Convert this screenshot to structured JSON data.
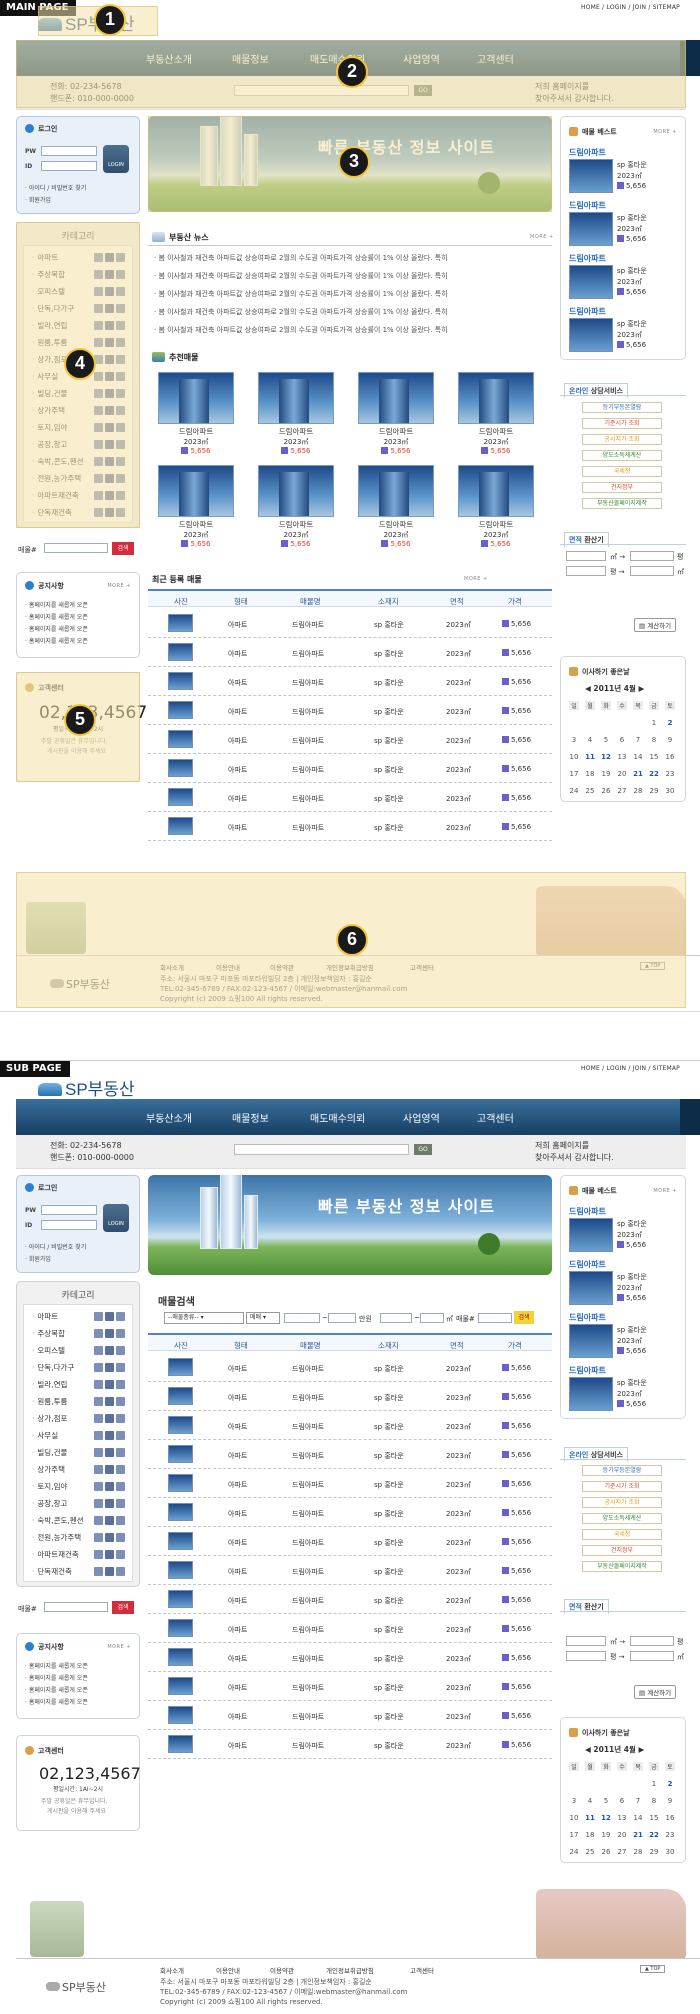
{
  "labels": {
    "main": "MAIN PAGE",
    "sub": "SUB PAGE"
  },
  "util": "HOME / LOGIN / JOIN / SITEMAP",
  "logo": "SP부동산",
  "nav": [
    "부동산소개",
    "매물정보",
    "매도매수의뢰",
    "사업영역",
    "고객센터"
  ],
  "info": {
    "phone": "전화: 02-234-5678",
    "mobile": "핸드폰: 010-000-0000",
    "go": "GO",
    "thanks1": "저희 홈페이지를",
    "thanks2": "찾아주셔서 감사합니다."
  },
  "login": {
    "title": "로그인",
    "pw": "PW",
    "id": "ID",
    "button": "LOGIN",
    "find": "· 아이디 / 비밀번호 찾기",
    "join": "· 회원가입"
  },
  "category": {
    "title": "카테고리",
    "items": [
      "아파트",
      "주상복합",
      "오피스텔",
      "단독,다가구",
      "빌라,연립",
      "원룸,투룸",
      "상가,점포",
      "사무실",
      "빌딩,건물",
      "상가주택",
      "토지,임야",
      "공장,창고",
      "숙박,콘도,펜션",
      "전원,농가주택",
      "아파트재건축",
      "단독재건축"
    ]
  },
  "product_search": {
    "label": "매물#",
    "button": "검색"
  },
  "notice": {
    "title": "공지사항",
    "more": "MORE +",
    "items": [
      "홈페이지를 새롭게 오픈",
      "홈페이지를 새롭게 오픈",
      "홈페이지를 새롭게 오픈",
      "홈페이지를 새롭게 오픈"
    ]
  },
  "cs": {
    "title": "고객센터",
    "phone": "02,123,4567",
    "hours": "평일시간: 1AI~2시",
    "note1": "주말 공휴일은 휴무입니다.",
    "note2": "게시판을 이용해 주세요"
  },
  "banner": {
    "title": "빠른 부동산 정보 사이트"
  },
  "news": {
    "title": "부동산 뉴스",
    "more": "MORE +",
    "items": [
      "봄 이사철과 재건축 아파트값 상승여파로 2월의 수도권 아파트가격 상승률이 1% 이상 올랐다. 특히",
      "봄 이사철과 재건축 아파트값 상승여파로 2월의 수도권 아파트가격 상승률이 1% 이상 올랐다. 특히",
      "봄 이사철과 재건축 아파트값 상승여파로 2월의 수도권 아파트가격 상승률이 1% 이상 올랐다. 특히",
      "봄 이사철과 재건축 아파트값 상승여파로 2월의 수도권 아파트가격 상승률이 1% 이상 올랐다. 특히",
      "봄 이사철과 재건축 아파트값 상승여파로 2월의 수도권 아파트가격 상승률이 1% 이상 올랐다. 특히"
    ]
  },
  "recommend": {
    "title": "추천매물",
    "name": "드림아파트",
    "area": "2023㎡",
    "price": "5,656"
  },
  "recent": {
    "title": "최근 등록 매물",
    "more": "MORE +"
  },
  "table": {
    "headers": [
      "사진",
      "형태",
      "매물명",
      "소재지",
      "면적",
      "가격"
    ],
    "type": "아파트",
    "name": "드림아파트",
    "loc": "sp 홍타운",
    "area": "2023㎡",
    "price": "5,656"
  },
  "best": {
    "title": "매물 베스트",
    "more": "MORE +",
    "name": "드림아파트",
    "loc": "sp 홍타운",
    "area": "2023㎡",
    "price": "5,656"
  },
  "online": {
    "title_a": "온라인",
    "title_b": "상담서비스",
    "items": [
      "등기부등본열람",
      "기준시가 조회",
      "공시지가 조회",
      "양도소득세계산",
      "국세청",
      "건지정부",
      "부동산몰페이지제작"
    ]
  },
  "area_calc": {
    "title_a": "면적",
    "title_b": "환산기",
    "unit1": "㎡ →",
    "unit2": "평 →",
    "out1": "평",
    "out2": "㎡",
    "button": "계산하기"
  },
  "calendar": {
    "title": "이사하기 좋은날",
    "month": "◀ 2011년 4월 ▶",
    "days": [
      "일",
      "월",
      "화",
      "수",
      "목",
      "금",
      "토"
    ],
    "weeks": [
      [
        "",
        "",
        "",
        "",
        "",
        "1",
        "2"
      ],
      [
        "3",
        "4",
        "5",
        "6",
        "7",
        "8",
        "9"
      ],
      [
        "10",
        "11",
        "12",
        "13",
        "14",
        "15",
        "16"
      ],
      [
        "17",
        "18",
        "19",
        "20",
        "21",
        "22",
        "23"
      ],
      [
        "24",
        "25",
        "26",
        "27",
        "28",
        "29",
        "30"
      ]
    ]
  },
  "footer": {
    "links": [
      "회사소개",
      "이용안내",
      "이용약관",
      "개인정보취급방침",
      "고객센터"
    ],
    "top": "▲ TOP",
    "addr1": "주소: 서울시 마포구 마포동 마포타워빌딩 2층 | 개인정보책임자 : 홍길순",
    "addr2": "TEL:02-345-6789 / FAX:02-123-4567 / 이메일:webmaster@hanmail.com",
    "copy": "Copyright (c) 2009 쇼핑100 All rights reserved."
  },
  "subsearch": {
    "title": "매물검색",
    "type": "--매물종류--",
    "deal": "매매",
    "won": "만원",
    "sqm": "㎡",
    "label": "매물#",
    "button": "검색"
  },
  "badges": [
    "1",
    "2",
    "3",
    "4",
    "5",
    "6"
  ]
}
